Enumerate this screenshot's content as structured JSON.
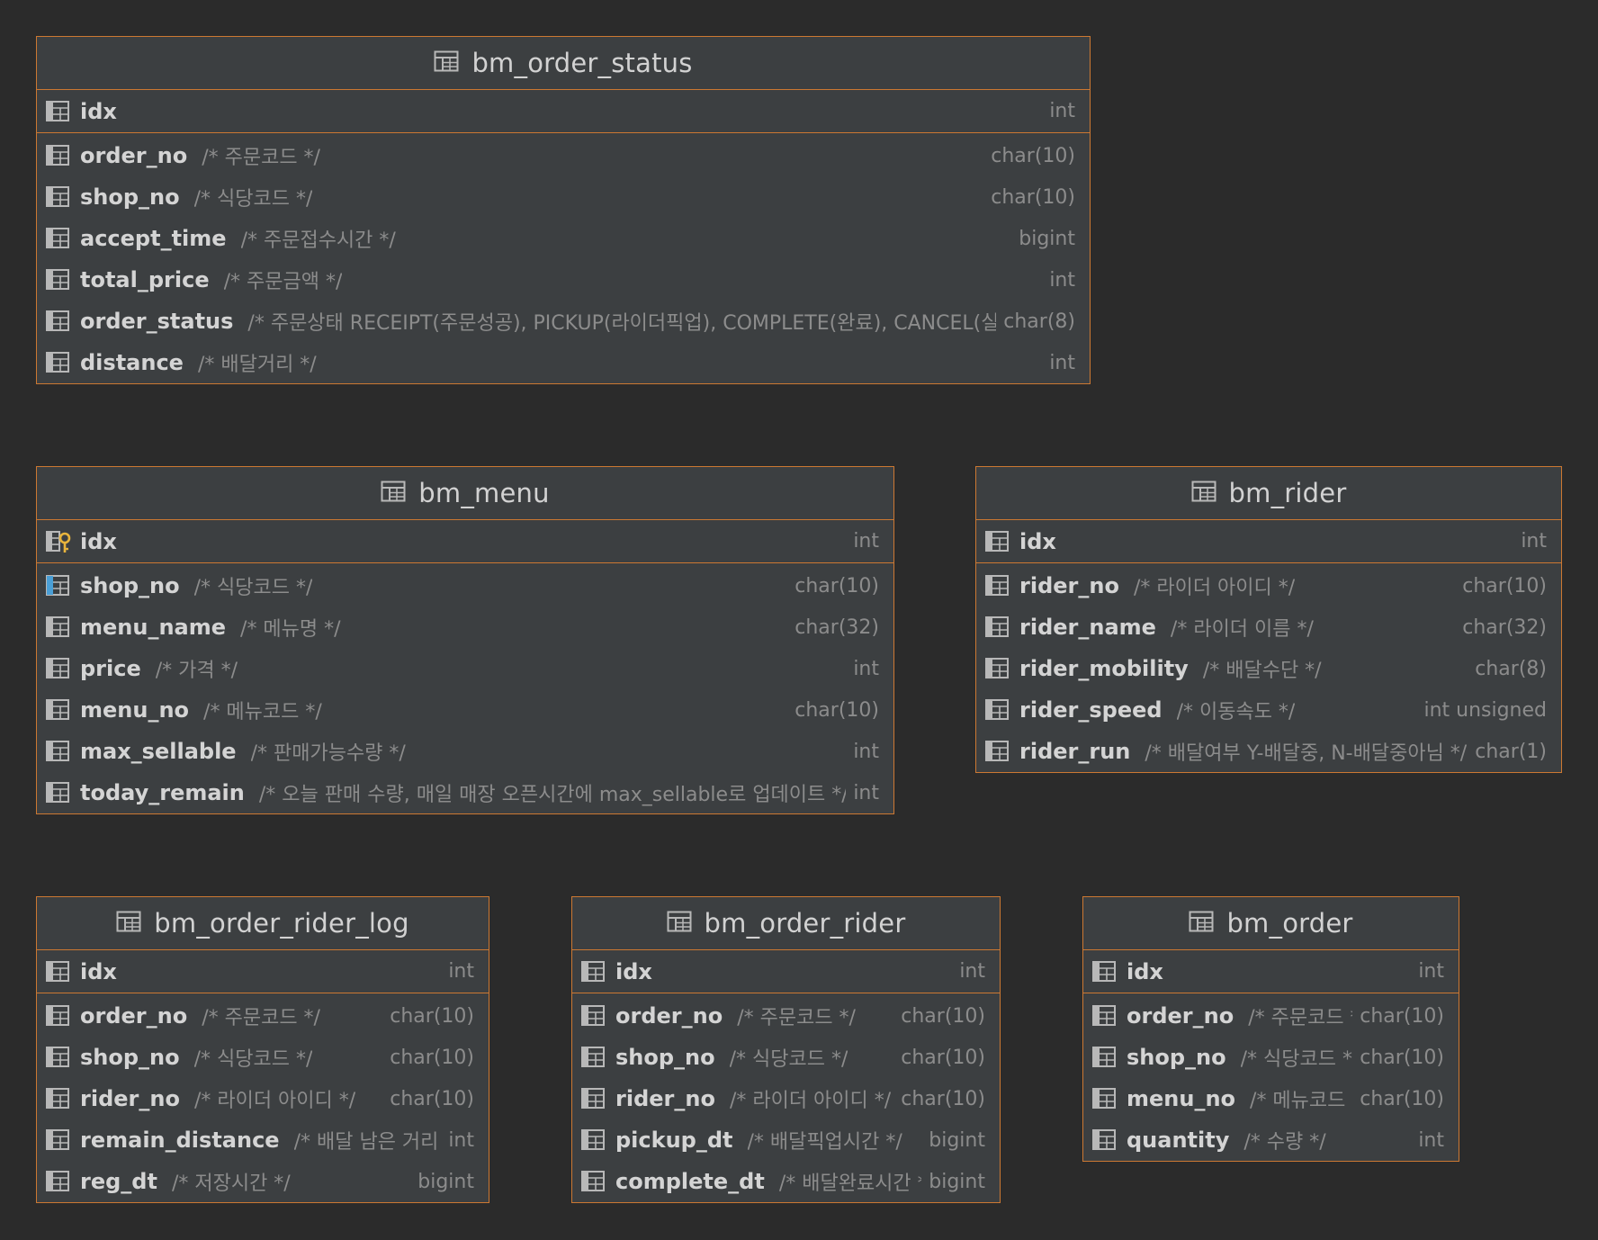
{
  "tables": [
    {
      "id": "bm_order_status",
      "name": "bm_order_status",
      "columns": [
        {
          "name": "idx",
          "comment": "",
          "type": "int",
          "key": "pk"
        },
        {
          "name": "order_no",
          "comment": "/* 주문코드 */",
          "type": "char(10)"
        },
        {
          "name": "shop_no",
          "comment": "/* 식당코드 */",
          "type": "char(10)"
        },
        {
          "name": "accept_time",
          "comment": "/* 주문접수시간 */",
          "type": "bigint"
        },
        {
          "name": "total_price",
          "comment": "/* 주문금액 */",
          "type": "int"
        },
        {
          "name": "order_status",
          "comment": "/* 주문상태 RECEIPT(주문성공), PICKUP(라이더픽업), COMPLETE(완료), CANCEL(실패) *,",
          "type": "char(8)"
        },
        {
          "name": "distance",
          "comment": "/* 배달거리 */",
          "type": "int"
        }
      ]
    },
    {
      "id": "bm_menu",
      "name": "bm_menu",
      "columns": [
        {
          "name": "idx",
          "comment": "",
          "type": "int",
          "key": "pk-key"
        },
        {
          "name": "shop_no",
          "comment": "/* 식당코드 */",
          "type": "char(10)",
          "key": "index"
        },
        {
          "name": "menu_name",
          "comment": "/* 메뉴명 */",
          "type": "char(32)"
        },
        {
          "name": "price",
          "comment": "/* 가격 */",
          "type": "int"
        },
        {
          "name": "menu_no",
          "comment": "/* 메뉴코드 */",
          "type": "char(10)"
        },
        {
          "name": "max_sellable",
          "comment": "/* 판매가능수량 */",
          "type": "int"
        },
        {
          "name": "today_remain",
          "comment": "/* 오늘 판매 수량, 매일 매장 오픈시간에 max_sellable로 업데이트 */",
          "type": "int"
        }
      ]
    },
    {
      "id": "bm_rider",
      "name": "bm_rider",
      "columns": [
        {
          "name": "idx",
          "comment": "",
          "type": "int",
          "key": "pk"
        },
        {
          "name": "rider_no",
          "comment": "/* 라이더 아이디 */",
          "type": "char(10)"
        },
        {
          "name": "rider_name",
          "comment": "/* 라이더 이름 */",
          "type": "char(32)"
        },
        {
          "name": "rider_mobility",
          "comment": "/* 배달수단 */",
          "type": "char(8)"
        },
        {
          "name": "rider_speed",
          "comment": "/* 이동속도 */",
          "type": "int unsigned"
        },
        {
          "name": "rider_run",
          "comment": "/* 배달여부 Y-배달중, N-배달중아님 */",
          "type": "char(1)"
        }
      ]
    },
    {
      "id": "bm_order_rider_log",
      "name": "bm_order_rider_log",
      "columns": [
        {
          "name": "idx",
          "comment": "",
          "type": "int",
          "key": "pk"
        },
        {
          "name": "order_no",
          "comment": "/* 주문코드 */",
          "type": "char(10)"
        },
        {
          "name": "shop_no",
          "comment": "/* 식당코드 */",
          "type": "char(10)"
        },
        {
          "name": "rider_no",
          "comment": "/* 라이더 아이디 */",
          "type": "char(10)"
        },
        {
          "name": "remain_distance",
          "comment": "/* 배달 남은 거리 */",
          "type": "int"
        },
        {
          "name": "reg_dt",
          "comment": "/* 저장시간 */",
          "type": "bigint"
        }
      ]
    },
    {
      "id": "bm_order_rider",
      "name": "bm_order_rider",
      "columns": [
        {
          "name": "idx",
          "comment": "",
          "type": "int",
          "key": "pk"
        },
        {
          "name": "order_no",
          "comment": "/* 주문코드 */",
          "type": "char(10)"
        },
        {
          "name": "shop_no",
          "comment": "/* 식당코드 */",
          "type": "char(10)"
        },
        {
          "name": "rider_no",
          "comment": "/* 라이더 아이디 */",
          "type": "char(10)"
        },
        {
          "name": "pickup_dt",
          "comment": "/* 배달픽업시간 */",
          "type": "bigint"
        },
        {
          "name": "complete_dt",
          "comment": "/* 배달완료시간 */",
          "type": "bigint"
        }
      ]
    },
    {
      "id": "bm_order",
      "name": "bm_order",
      "columns": [
        {
          "name": "idx",
          "comment": "",
          "type": "int",
          "key": "pk"
        },
        {
          "name": "order_no",
          "comment": "/* 주문코드 */",
          "type": "char(10)"
        },
        {
          "name": "shop_no",
          "comment": "/* 식당코드 */",
          "type": "char(10)"
        },
        {
          "name": "menu_no",
          "comment": "/* 메뉴코드 */",
          "type": "char(10)"
        },
        {
          "name": "quantity",
          "comment": "/* 수량 */",
          "type": "int"
        }
      ]
    }
  ],
  "colors": {
    "background": "#2b2b2b",
    "table_fill": "#3c3f41",
    "border": "#cc7832",
    "key_icon": "#e8b43c",
    "index_marker": "#4a9fd6"
  }
}
